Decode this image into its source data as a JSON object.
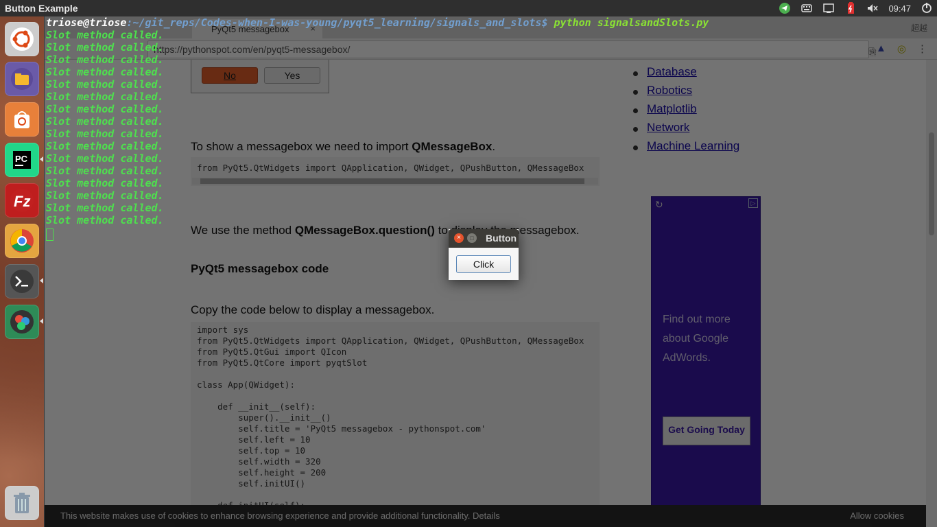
{
  "window_title": "Button Example",
  "tray": {
    "clock": "09:47"
  },
  "browser": {
    "tab_label": "PyQt5 messagebox",
    "url": "https://pythonspot.com/en/pyqt5-messagebox/",
    "ext_label": "超越"
  },
  "page": {
    "btn_no": "No",
    "btn_yes": "Yes",
    "para1_pre": "To show a messagebox we need to import ",
    "para1_bold": "QMessageBox",
    "para1_post": ".",
    "code1": "from PyQt5.QtWidgets import QApplication, QWidget, QPushButton, QMessageBox",
    "para2_pre": "We use the method ",
    "para2_bold": "QMessageBox.question()",
    "para2_post": " to display the messagebox.",
    "heading": "PyQt5 messagebox code",
    "para3": "Copy the code below to display a messagebox.",
    "code2": [
      "import sys",
      "from PyQt5.QtWidgets import QApplication, QWidget, QPushButton, QMessageBox",
      "from PyQt5.QtGui import QIcon",
      "from PyQt5.QtCore import pyqtSlot",
      "",
      "class App(QWidget):",
      "",
      "    def __init__(self):",
      "        super().__init__()",
      "        self.title = 'PyQt5 messagebox - pythonspot.com'",
      "        self.left = 10",
      "        self.top = 10",
      "        self.width = 320",
      "        self.height = 200",
      "        self.initUI()",
      "",
      "    def initUI(self):"
    ],
    "sidebar_links": [
      "Database",
      "Robotics",
      "Matplotlib",
      "Network",
      "Machine Learning"
    ],
    "ad_text": "Find out more about Google AdWords.",
    "ad_cta": "Get Going Today",
    "cookie_msg": "This website makes use of cookies to enhance browsing experience and provide additional functionality. Details",
    "cookie_allow": "Allow cookies"
  },
  "terminal": {
    "prompt_user": "triose@triose",
    "prompt_path": ":~/git_reps/Codes-when-I-was-young/pyqt5_learning/signals_and_slots$ ",
    "command": "python signalsandSlots.py",
    "slot_line": "Slot method called.",
    "slot_count": 16
  },
  "dialog": {
    "title": "Button Example",
    "button": "Click"
  },
  "colors": {
    "terminal_green": "#4ee04e",
    "close_orange": "#e5532d",
    "ad_purple": "#3a1aa8"
  }
}
